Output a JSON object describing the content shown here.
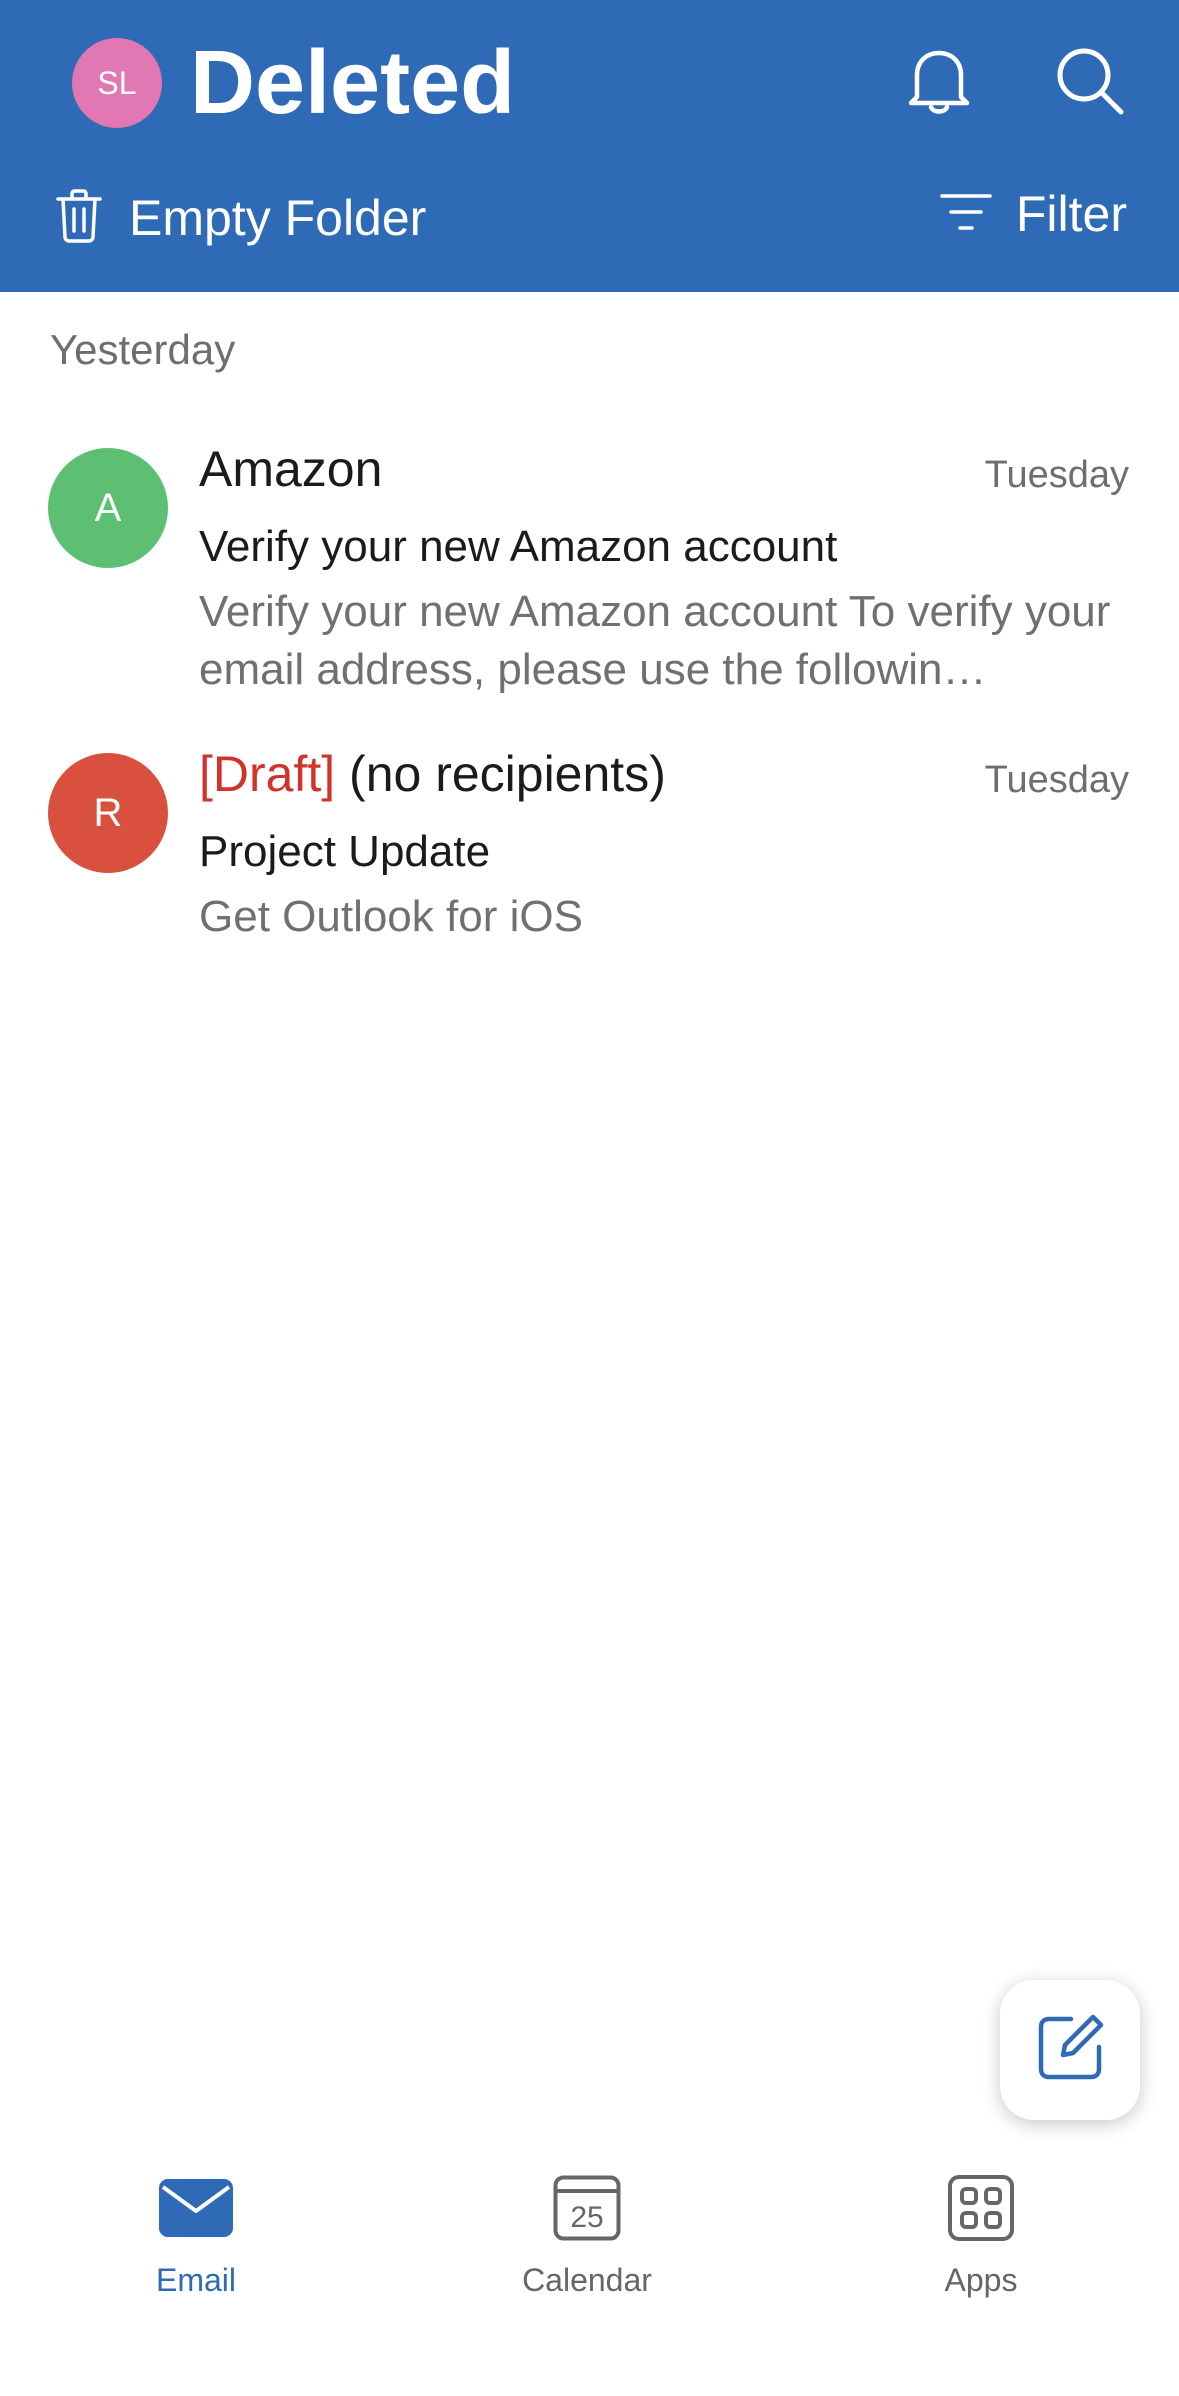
{
  "colors": {
    "header_bg": "#2f6ab7",
    "accent": "#2f6ab7",
    "draft_red": "#d0332a",
    "avatar_me": "#e178b4",
    "avatar_amazon": "#5dbf72",
    "avatar_draft": "#d9503f"
  },
  "header": {
    "account_initials": "SL",
    "folder_title": "Deleted",
    "bell_icon": "bell-icon",
    "search_icon": "search-icon"
  },
  "toolbar": {
    "empty_folder_label": "Empty Folder",
    "empty_folder_icon": "trash-icon",
    "filter_label": "Filter",
    "filter_icon": "filter-icon"
  },
  "message_list": {
    "section_label": "Yesterday",
    "messages": [
      {
        "avatar_initial": "A",
        "sender": "Amazon",
        "date": "Tuesday",
        "subject": "Verify your new Amazon account",
        "preview": "Verify your new Amazon account To verify your email address, please use the followin…"
      },
      {
        "avatar_initial": "R",
        "draft_tag": "[Draft]",
        "sender": "(no recipients)",
        "date": "Tuesday",
        "subject": "Project Update",
        "preview": "Get Outlook for iOS"
      }
    ]
  },
  "compose": {
    "icon": "compose-icon"
  },
  "tabbar": {
    "items": [
      {
        "label": "Email",
        "icon": "mail-icon",
        "selected": true
      },
      {
        "label": "Calendar",
        "icon": "calendar-icon",
        "day": "25",
        "selected": false
      },
      {
        "label": "Apps",
        "icon": "apps-grid-icon",
        "selected": false
      }
    ]
  }
}
